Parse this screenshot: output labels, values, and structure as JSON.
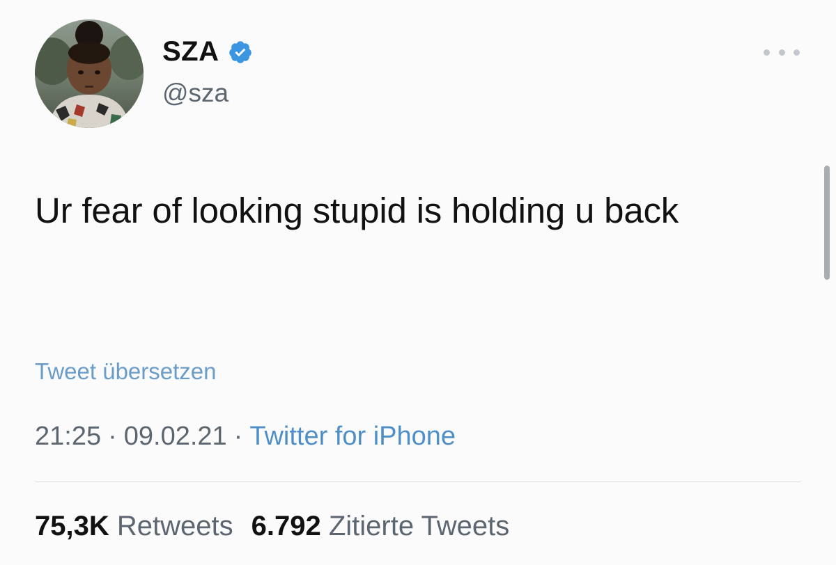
{
  "author": {
    "display_name": "SZA",
    "handle": "@sza",
    "verified": true,
    "avatar": "child-portrait-avatar"
  },
  "tweet": {
    "text": "Ur fear of looking stupid is holding u back",
    "translate_label": "Tweet übersetzen"
  },
  "meta": {
    "time": "21:25",
    "separator": "·",
    "date": "09.02.21",
    "source": "Twitter for iPhone"
  },
  "stats": {
    "retweets_count": "75,3K",
    "retweets_label": "Retweets",
    "quotes_count": "6.792",
    "quotes_label": "Zitierte Tweets"
  },
  "icons": {
    "verified": "verified-badge-icon",
    "more": "more-options-icon"
  },
  "colors": {
    "link": "#4f8fc8",
    "verified": "#3b95e0",
    "secondary_text": "#5c6670"
  }
}
